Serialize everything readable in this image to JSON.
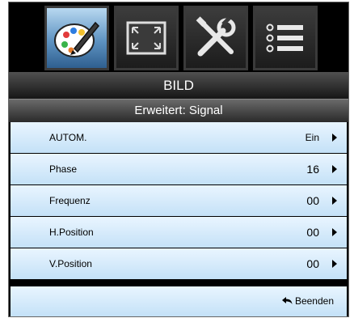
{
  "tabs": [
    {
      "icon": "palette-icon",
      "active": true
    },
    {
      "icon": "screen-fit-icon",
      "active": false
    },
    {
      "icon": "tools-icon",
      "active": false
    },
    {
      "icon": "options-list-icon",
      "active": false
    }
  ],
  "menu": {
    "title": "BILD",
    "subtitle": "Erweitert: Signal"
  },
  "rows": [
    {
      "label": "AUTOM.",
      "value": "Ein"
    },
    {
      "label": "Phase",
      "value": "16"
    },
    {
      "label": "Frequenz",
      "value": "00"
    },
    {
      "label": "H.Position",
      "value": "00"
    },
    {
      "label": "V.Position",
      "value": "00"
    }
  ],
  "footer": {
    "exit_label": "Beenden"
  },
  "colors": {
    "active_tab": "#5e93c2",
    "row_bg": "#d6ebfb",
    "frame": "#000000"
  }
}
